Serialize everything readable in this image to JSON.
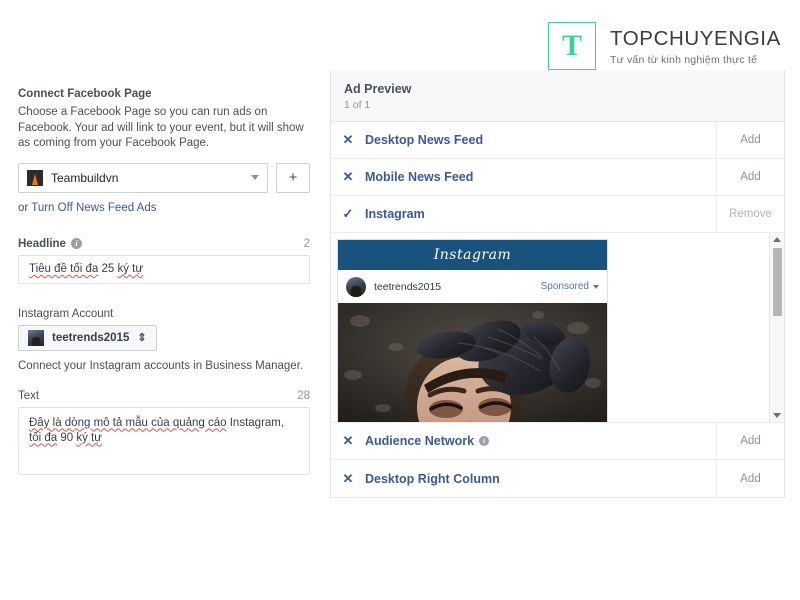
{
  "brand": {
    "mark_letter": "T",
    "name": "TOPCHUYENGIA",
    "tagline": "Tư vấn từ kinh nghiệm thực tế",
    "accent_color": "#3fcf9a"
  },
  "left_form": {
    "connect_page": {
      "label": "Connect Facebook Page",
      "help": "Choose a Facebook Page so you can run ads on Facebook. Your ad will link to your event, but it will show as coming from your Facebook Page.",
      "selected_page": "Teambuildvn",
      "add_button_label": "+",
      "or_prefix": "or ",
      "turn_off_link": "Turn Off News Feed Ads"
    },
    "headline": {
      "label": "Headline",
      "info_glyph": "i",
      "counter": "2",
      "value": "Tiêu đề tối đa 25 ký tự",
      "value_parts": {
        "a": "Tiêu đề tối đa",
        "b": " 25 ",
        "c": "ký tự"
      }
    },
    "instagram_account": {
      "label": "Instagram Account",
      "selected": "teetrends2015",
      "stepper_glyph": "⇕",
      "note": "Connect your Instagram accounts in Business Manager."
    },
    "text": {
      "label": "Text",
      "counter": "28",
      "value": "Đây là dòng mô tả mẫu của quảng cáo Instagram, tối đa 90 ký tự",
      "value_parts": {
        "a": "Đây là dòng mô tả mẫu của quảng cáo",
        "b": " Instagram, ",
        "c": "tối đa",
        "d": " 90 ",
        "e": "ký tự"
      }
    }
  },
  "ad_preview": {
    "title": "Ad Preview",
    "subtitle": "1 of 1",
    "placements": [
      {
        "name": "Desktop News Feed",
        "icon": "close-icon",
        "icon_glyph": "✕",
        "action": "Add",
        "active": false
      },
      {
        "name": "Mobile News Feed",
        "icon": "close-icon",
        "icon_glyph": "✕",
        "action": "Add",
        "active": false
      },
      {
        "name": "Instagram",
        "icon": "check-icon",
        "icon_glyph": "✓",
        "action": "Remove",
        "active": true
      },
      {
        "name": "Audience Network",
        "icon": "close-icon",
        "icon_glyph": "✕",
        "action": "Add",
        "active": false,
        "has_info": true
      },
      {
        "name": "Desktop Right Column",
        "icon": "close-icon",
        "icon_glyph": "✕",
        "action": "Add",
        "active": false
      }
    ],
    "instagram_preview": {
      "header_wordmark": "Instagram",
      "header_color": "#1a527e",
      "username": "teetrends2015",
      "sponsored_label": "Sponsored",
      "photo_description": "dark portrait photo of a woman wearing a black feathered headpiece"
    }
  }
}
